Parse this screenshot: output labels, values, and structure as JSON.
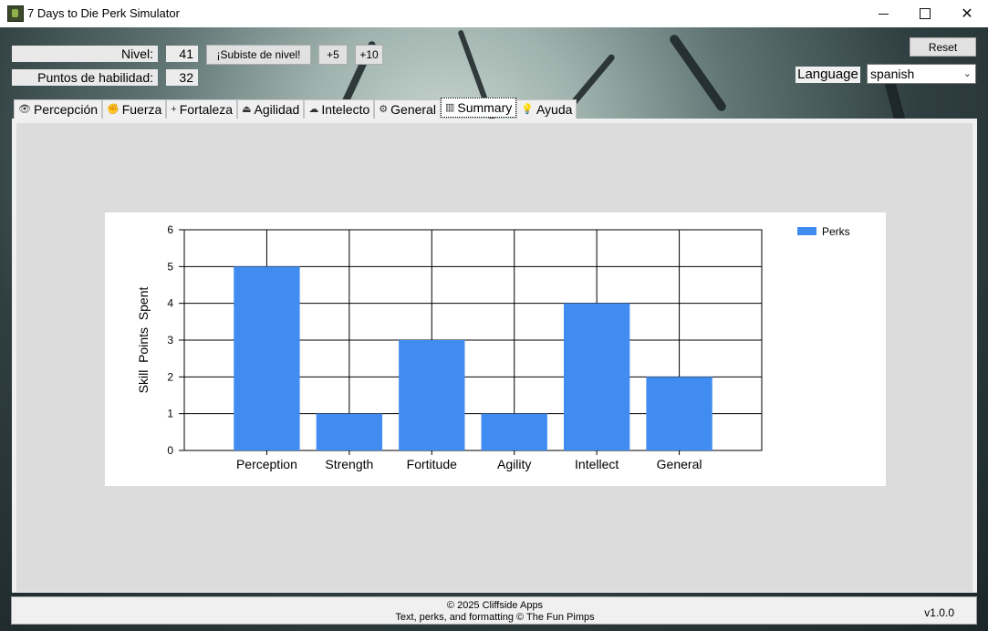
{
  "window": {
    "title": "7 Days to Die Perk Simulator"
  },
  "header": {
    "level_label": "Nivel:",
    "level_value": "41",
    "skill_points_label": "Puntos de habilidad:",
    "skill_points_value": "32",
    "level_up_button": "¡Subiste de nivel!",
    "plus5_button": "+5",
    "plus10_button": "+10",
    "reset_button": "Reset",
    "language_label": "Language",
    "language_value": "spanish"
  },
  "tabs": [
    {
      "label": "Percepción",
      "icon": "eye-icon",
      "glyph": "👁"
    },
    {
      "label": "Fuerza",
      "icon": "fist-icon",
      "glyph": "✊"
    },
    {
      "label": "Fortaleza",
      "icon": "plus-icon",
      "glyph": "+"
    },
    {
      "label": "Agilidad",
      "icon": "shoe-icon",
      "glyph": "⏏"
    },
    {
      "label": "Intelecto",
      "icon": "brain-icon",
      "glyph": "☁"
    },
    {
      "label": "General",
      "icon": "gear-icon",
      "glyph": "⚙"
    },
    {
      "label": "Summary",
      "icon": "bar-chart-icon",
      "glyph": "▥"
    },
    {
      "label": "Ayuda",
      "icon": "bulb-icon",
      "glyph": "💡"
    }
  ],
  "active_tab": "Summary",
  "chart_data": {
    "type": "bar",
    "categories": [
      "Perception",
      "Strength",
      "Fortitude",
      "Agility",
      "Intellect",
      "General"
    ],
    "series": [
      {
        "name": "Perks",
        "values": [
          5,
          1,
          3,
          1,
          4,
          2
        ],
        "color": "#418CF0"
      }
    ],
    "ylabel": "Skill  Points  Spent",
    "ylim": [
      0,
      6
    ],
    "yticks": [
      0,
      1,
      2,
      3,
      4,
      5,
      6
    ],
    "grid": true,
    "legend": "top-right"
  },
  "footer": {
    "line1": "© 2025 Cliffside Apps",
    "line2": "Text, perks, and formatting © The Fun Pimps",
    "version": "v1.0.0"
  }
}
